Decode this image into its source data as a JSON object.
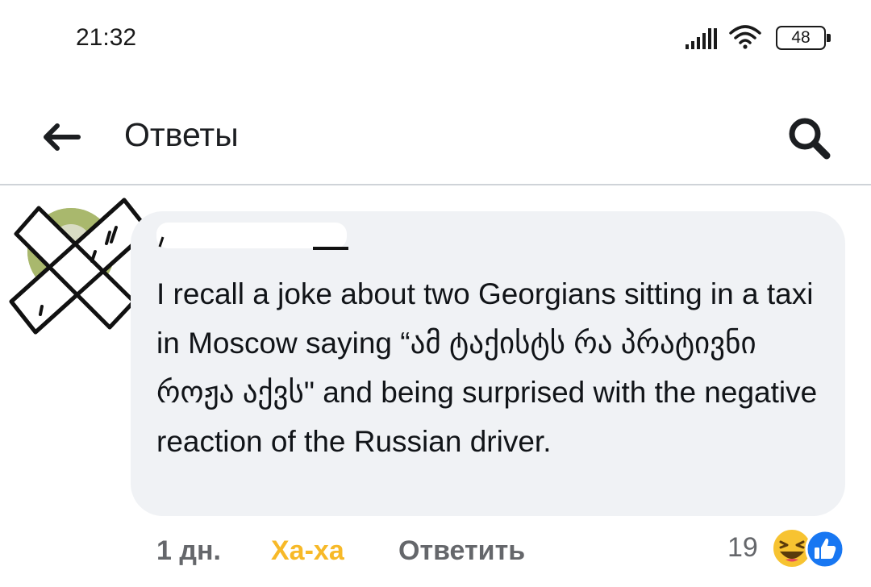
{
  "status_bar": {
    "time": "21:32",
    "battery_level": "48",
    "icons": [
      "signal-icon",
      "wifi-icon",
      "battery-icon"
    ]
  },
  "header": {
    "title": "Ответы",
    "icons": [
      "arrow-left-icon",
      "search-icon"
    ]
  },
  "comment": {
    "author": "",
    "text": "I recall a joke about two Georgians sitting in a taxi in Moscow saying “ამ ტაქისტს რა პრატივნი როჟა აქვს\" and being surprised with the negative reaction of the Russian driver.",
    "time_ago": "1 дн.",
    "reaction_label": "Ха-ха",
    "reply_label": "Ответить",
    "reaction_count": "19",
    "reaction_icons": [
      "haha-icon",
      "like-icon"
    ]
  },
  "colors": {
    "bubble": "#f0f2f5",
    "haha": "#f7b928",
    "like": "#1877f2",
    "muted": "#65676b"
  }
}
